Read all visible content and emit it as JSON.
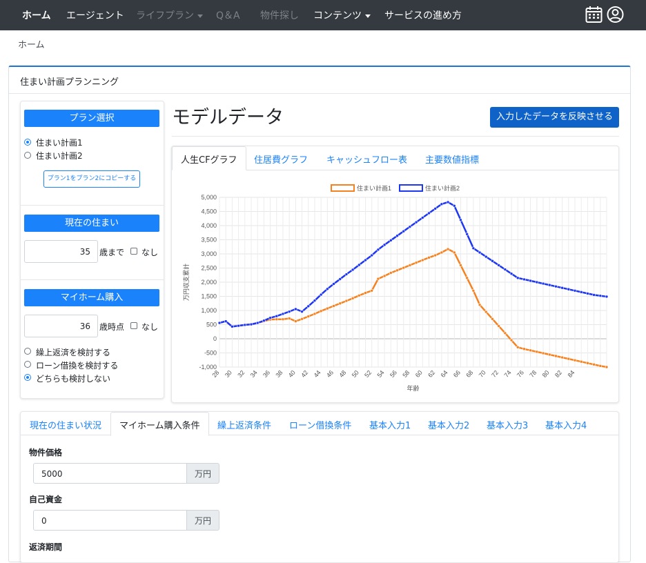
{
  "navbar": {
    "items": [
      {
        "label": "ホーム"
      },
      {
        "label": "エージェント"
      },
      {
        "label": "ライフプラン"
      },
      {
        "label": "Q＆A"
      },
      {
        "label": "物件探し"
      },
      {
        "label": "コンテンツ"
      },
      {
        "label": "サービスの進め方"
      }
    ],
    "icons": [
      "calendar-icon",
      "user-account-icon"
    ]
  },
  "breadcrumb": "ホーム",
  "card_title": "住まい計画プランニング",
  "left_panel": {
    "plan_header": "プラン選択",
    "plans": [
      {
        "label": "住まい計画1",
        "selected": true
      },
      {
        "label": "住まい計画2",
        "selected": false
      }
    ],
    "copy_button": "プラン1をプラン2にコピーする",
    "current_home_header": "現在の住まい",
    "current_home_age": "35",
    "current_home_suffix": "歳まで",
    "none_label": "なし",
    "purchase_header": "マイホーム購入",
    "purchase_age": "36",
    "purchase_suffix": "歳時点",
    "options": [
      {
        "label": "繰上返済を検討する",
        "selected": false
      },
      {
        "label": "ローン借換を検討する",
        "selected": false
      },
      {
        "label": "どちらも検討しない",
        "selected": true
      }
    ]
  },
  "main": {
    "heading": "モデルデータ",
    "reflect_button": "入力したデータを反映させる",
    "tabs": [
      "人生CFグラフ",
      "住居費グラフ",
      "キャッシュフロー表",
      "主要数値指標"
    ]
  },
  "chart_data": {
    "type": "line",
    "title": "",
    "xlabel": "年齢",
    "ylabel": "万円収支累計",
    "ylim": [
      -1000,
      5000
    ],
    "yticks": [
      -1000,
      -500,
      0,
      500,
      1000,
      1500,
      2000,
      2500,
      3000,
      3500,
      4000,
      4500,
      5000
    ],
    "xticks": [
      28,
      30,
      32,
      34,
      36,
      38,
      40,
      42,
      44,
      46,
      48,
      50,
      52,
      54,
      56,
      58,
      60,
      62,
      64,
      66,
      68,
      70,
      72,
      74,
      76,
      78,
      80,
      82,
      84
    ],
    "grid": true,
    "legend_position": "top",
    "series": [
      {
        "name": "住まい計画1",
        "color": "#f58220",
        "points": [
          [
            28,
            560
          ],
          [
            29,
            620
          ],
          [
            30,
            430
          ],
          [
            31,
            460
          ],
          [
            32,
            490
          ],
          [
            33,
            510
          ],
          [
            34,
            560
          ],
          [
            35,
            620
          ],
          [
            36,
            680
          ],
          [
            37,
            690
          ],
          [
            38,
            690
          ],
          [
            39,
            720
          ],
          [
            40,
            620
          ],
          [
            41,
            700
          ],
          [
            42,
            790
          ],
          [
            43,
            880
          ],
          [
            44,
            980
          ],
          [
            45,
            1070
          ],
          [
            46,
            1160
          ],
          [
            47,
            1250
          ],
          [
            48,
            1340
          ],
          [
            49,
            1430
          ],
          [
            50,
            1530
          ],
          [
            51,
            1620
          ],
          [
            52,
            1700
          ],
          [
            53,
            2120
          ],
          [
            54,
            2220
          ],
          [
            55,
            2330
          ],
          [
            56,
            2420
          ],
          [
            57,
            2510
          ],
          [
            58,
            2600
          ],
          [
            59,
            2690
          ],
          [
            60,
            2780
          ],
          [
            61,
            2870
          ],
          [
            62,
            2950
          ],
          [
            63,
            3050
          ],
          [
            64,
            3170
          ],
          [
            65,
            3050
          ],
          [
            66,
            2600
          ],
          [
            67,
            2150
          ],
          [
            68,
            1700
          ],
          [
            69,
            1200
          ],
          [
            70,
            950
          ],
          [
            71,
            700
          ],
          [
            72,
            450
          ],
          [
            73,
            200
          ],
          [
            74,
            -50
          ],
          [
            75,
            -300
          ],
          [
            76,
            -360
          ],
          [
            77,
            -410
          ],
          [
            78,
            -460
          ],
          [
            79,
            -510
          ],
          [
            80,
            -560
          ],
          [
            81,
            -610
          ],
          [
            82,
            -660
          ],
          [
            83,
            -710
          ],
          [
            84,
            -760
          ],
          [
            85,
            -810
          ],
          [
            86,
            -860
          ],
          [
            87,
            -910
          ],
          [
            88,
            -960
          ],
          [
            89,
            -1000
          ]
        ]
      },
      {
        "name": "住まい計画2",
        "color": "#1d36f2",
        "points": [
          [
            28,
            560
          ],
          [
            29,
            620
          ],
          [
            30,
            430
          ],
          [
            31,
            460
          ],
          [
            32,
            490
          ],
          [
            33,
            510
          ],
          [
            34,
            560
          ],
          [
            35,
            640
          ],
          [
            36,
            740
          ],
          [
            37,
            800
          ],
          [
            38,
            880
          ],
          [
            39,
            960
          ],
          [
            40,
            1050
          ],
          [
            41,
            960
          ],
          [
            42,
            1150
          ],
          [
            43,
            1350
          ],
          [
            44,
            1560
          ],
          [
            45,
            1760
          ],
          [
            46,
            1940
          ],
          [
            47,
            2110
          ],
          [
            48,
            2280
          ],
          [
            49,
            2440
          ],
          [
            50,
            2610
          ],
          [
            51,
            2780
          ],
          [
            52,
            2950
          ],
          [
            53,
            3150
          ],
          [
            54,
            3320
          ],
          [
            55,
            3480
          ],
          [
            56,
            3640
          ],
          [
            57,
            3800
          ],
          [
            58,
            3960
          ],
          [
            59,
            4120
          ],
          [
            60,
            4280
          ],
          [
            61,
            4440
          ],
          [
            62,
            4600
          ],
          [
            63,
            4760
          ],
          [
            64,
            4830
          ],
          [
            65,
            4700
          ],
          [
            66,
            4200
          ],
          [
            67,
            3700
          ],
          [
            68,
            3200
          ],
          [
            69,
            3050
          ],
          [
            70,
            2900
          ],
          [
            71,
            2750
          ],
          [
            72,
            2600
          ],
          [
            73,
            2450
          ],
          [
            74,
            2300
          ],
          [
            75,
            2150
          ],
          [
            76,
            2100
          ],
          [
            77,
            2050
          ],
          [
            78,
            2000
          ],
          [
            79,
            1950
          ],
          [
            80,
            1900
          ],
          [
            81,
            1850
          ],
          [
            82,
            1800
          ],
          [
            83,
            1750
          ],
          [
            84,
            1700
          ],
          [
            85,
            1650
          ],
          [
            86,
            1600
          ],
          [
            87,
            1550
          ],
          [
            88,
            1520
          ],
          [
            89,
            1490
          ]
        ]
      }
    ]
  },
  "bottom": {
    "tabs": [
      "現在の住まい状況",
      "マイホーム購入条件",
      "繰上返済条件",
      "ローン借換条件",
      "基本入力1",
      "基本入力2",
      "基本入力3",
      "基本入力4"
    ],
    "active_tab": 1,
    "fields": [
      {
        "label": "物件価格",
        "value": "5000",
        "unit": "万円"
      },
      {
        "label": "自己資金",
        "value": "0",
        "unit": "万円"
      },
      {
        "label": "返済期間"
      }
    ]
  }
}
